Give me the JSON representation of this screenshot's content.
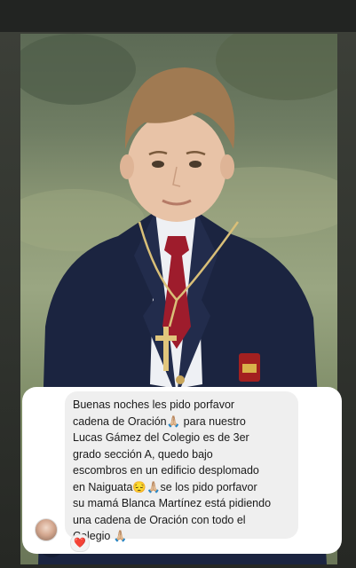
{
  "story": {
    "message": "Buenas noches les pido porfavor\ncadena de Oración🙏🏼 para nuestro\nLucas Gámez del Colegio es de 3er\ngrado sección A, quedo bajo\nescombros en un edificio desplomado\nen Naiguata😔🙏🏼se los pido porfavor\nsu mamá Blanca Martínez está pidiendo\nuna cadena de Oración con todo el\nColegio 🙏🏼",
    "reaction": "❤️"
  },
  "icons": {
    "reaction": "heart-icon",
    "sender": "avatar"
  },
  "colors": {
    "blazer": "#1b2440",
    "tie": "#9e1c2c",
    "bubble": "#efefef"
  }
}
